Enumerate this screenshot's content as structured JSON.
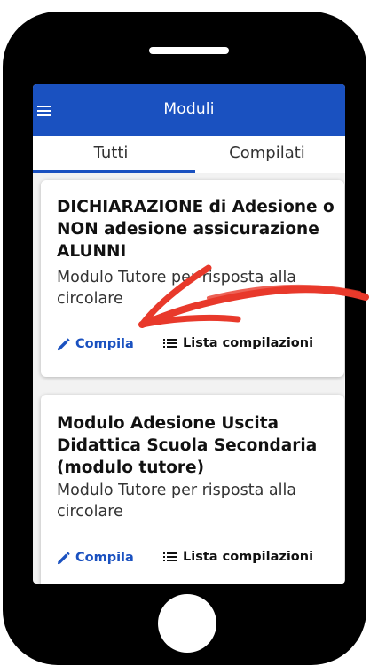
{
  "appbar": {
    "title": "Moduli"
  },
  "tabs": [
    {
      "label": "Tutti",
      "active": true
    },
    {
      "label": "Compilati",
      "active": false
    }
  ],
  "cards": [
    {
      "title": "DICHIARAZIONE di Adesione o NON adesione assicurazione ALUNNI",
      "subtitle": "Modulo Tutore per risposta alla circolare",
      "compila_label": "Compila",
      "lista_label": "Lista compilazioni"
    },
    {
      "title": "Modulo Adesione Uscita Didattica Scuola Secondaria (modulo tutore)",
      "subtitle": "Modulo Tutore per risposta alla circolare",
      "compila_label": "Compila",
      "lista_label": "Lista compilazioni"
    }
  ],
  "colors": {
    "primary": "#1a51c0",
    "annotation": "#e8392b"
  },
  "icons": [
    "menu-icon",
    "pencil-icon",
    "list-icon",
    "arrow-annotation"
  ]
}
